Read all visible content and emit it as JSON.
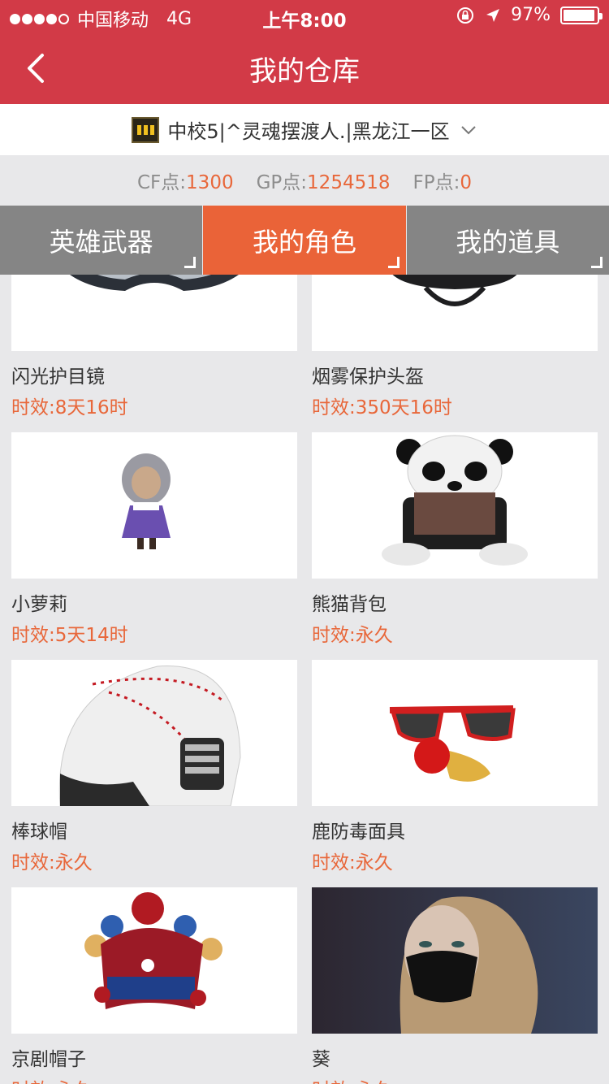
{
  "status_bar": {
    "carrier": "中国移动",
    "network": "4G",
    "time": "上午8:00",
    "battery": "97%"
  },
  "header": {
    "title": "我的仓库"
  },
  "account": {
    "name": "中校5|^灵魂摆渡人.|黑龙江一区"
  },
  "points": {
    "cf_label": "CF点:",
    "cf_value": "1300",
    "gp_label": "GP点:",
    "gp_value": "1254518",
    "fp_label": "FP点:",
    "fp_value": "0"
  },
  "tabs": [
    {
      "label": "英雄武器",
      "active": false
    },
    {
      "label": "我的角色",
      "active": true
    },
    {
      "label": "我的道具",
      "active": false
    }
  ],
  "items": [
    {
      "name": "闪光护目镜",
      "duration": "时效:8天16时",
      "icon": "goggles-image"
    },
    {
      "name": "烟雾保护头盔",
      "duration": "时效:350天16时",
      "icon": "helmet-image"
    },
    {
      "name": "小萝莉",
      "duration": "时效:5天14时",
      "icon": "girl-character-image"
    },
    {
      "name": "熊猫背包",
      "duration": "时效:永久",
      "icon": "panda-backpack-image"
    },
    {
      "name": "棒球帽",
      "duration": "时效:永久",
      "icon": "baseball-helmet-image"
    },
    {
      "name": "鹿防毒面具",
      "duration": "时效:永久",
      "icon": "sunglasses-nose-image"
    },
    {
      "name": "京剧帽子",
      "duration": "时效:永久",
      "icon": "opera-hat-image"
    },
    {
      "name": "葵",
      "duration": "时效:永久",
      "icon": "character-portrait-image"
    }
  ],
  "colors": {
    "header": "#d23a47",
    "accent": "#e8673a",
    "tab_inactive": "#858585",
    "tab_active": "#ea6338"
  }
}
